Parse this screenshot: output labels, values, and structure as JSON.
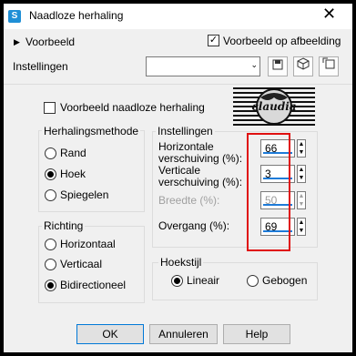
{
  "window": {
    "title": "Naadloze herhaling",
    "app_icon_glyph": "S",
    "close_glyph": "✕"
  },
  "preview_row": {
    "expander_label": "Voorbeeld",
    "preview_on_image_label": "Voorbeeld op afbeelding",
    "preview_on_image_checked": true
  },
  "settings_row": {
    "label": "Instellingen",
    "preset_value": ""
  },
  "seamless_preview_label": "Voorbeeld naadloze herhaling",
  "logo_text": "claudia",
  "method": {
    "group_label": "Herhalingsmethode",
    "options": [
      {
        "label": "Rand",
        "selected": false
      },
      {
        "label": "Hoek",
        "selected": true
      },
      {
        "label": "Spiegelen",
        "selected": false
      }
    ]
  },
  "direction": {
    "group_label": "Richting",
    "options": [
      {
        "label": "Horizontaal",
        "selected": false
      },
      {
        "label": "Verticaal",
        "selected": false
      },
      {
        "label": "Bidirectioneel",
        "selected": true
      }
    ]
  },
  "settings": {
    "group_label": "Instellingen",
    "horizontal": {
      "label": "Horizontale verschuiving (%):",
      "value": "66"
    },
    "vertical": {
      "label": "Verticale verschuiving (%):",
      "value": "3"
    },
    "width": {
      "label": "Breedte (%):",
      "value": "50"
    },
    "transition": {
      "label": "Overgang (%):",
      "value": "69"
    }
  },
  "corner_style": {
    "group_label": "Hoekstijl",
    "options": [
      {
        "label": "Lineair",
        "selected": true
      },
      {
        "label": "Gebogen",
        "selected": false
      }
    ]
  },
  "buttons": {
    "ok": "OK",
    "cancel": "Annuleren",
    "help": "Help"
  },
  "colors": {
    "highlight": "#e01010",
    "accent": "#1e7bd8",
    "title_bg": "#ffffff",
    "dialog_bg": "#f0f0f0"
  }
}
